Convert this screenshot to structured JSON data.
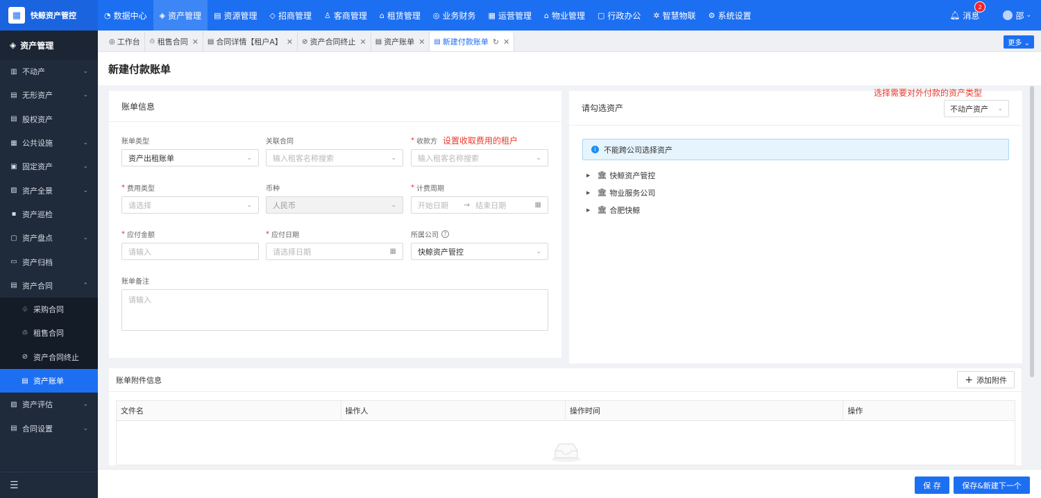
{
  "brand": {
    "name": "快鲸资产管控",
    "logo_icon": "building-icon"
  },
  "topnav": [
    {
      "label": "数据中心",
      "icon": "◔",
      "active": false
    },
    {
      "label": "资产管理",
      "icon": "◈",
      "active": true
    },
    {
      "label": "资源管理",
      "icon": "▤",
      "active": false
    },
    {
      "label": "招商管理",
      "icon": "◇",
      "active": false
    },
    {
      "label": "客商管理",
      "icon": "♙",
      "active": false
    },
    {
      "label": "租赁管理",
      "icon": "⌂",
      "active": false
    },
    {
      "label": "业务财务",
      "icon": "◎",
      "active": false
    },
    {
      "label": "运营管理",
      "icon": "▦",
      "active": false
    },
    {
      "label": "物业管理",
      "icon": "⌂",
      "active": false
    },
    {
      "label": "行政办公",
      "icon": "▢",
      "active": false
    },
    {
      "label": "智慧物联",
      "icon": "✲",
      "active": false
    },
    {
      "label": "系统设置",
      "icon": "⚙",
      "active": false
    }
  ],
  "top_right": {
    "messages_label": "消息",
    "messages_count": "2",
    "user_name": "邵"
  },
  "sidebar": {
    "title": "资产管理",
    "items": [
      {
        "label": "不动产",
        "icon": "▥",
        "chevron": "⌄"
      },
      {
        "label": "无形资产",
        "icon": "▤",
        "chevron": "⌄"
      },
      {
        "label": "股权资产",
        "icon": "▤",
        "chevron": ""
      },
      {
        "label": "公共设施",
        "icon": "▦",
        "chevron": "⌄"
      },
      {
        "label": "固定资产",
        "icon": "▣",
        "chevron": "⌄"
      },
      {
        "label": "资产全景",
        "icon": "▨",
        "chevron": "⌄"
      },
      {
        "label": "资产巡检",
        "icon": "▪",
        "chevron": ""
      },
      {
        "label": "资产盘点",
        "icon": "▢",
        "chevron": "⌄"
      },
      {
        "label": "资产归档",
        "icon": "▭",
        "chevron": ""
      },
      {
        "label": "资产合同",
        "icon": "▤",
        "chevron": "⌃"
      }
    ],
    "sub_items": [
      {
        "label": "采购合同",
        "icon": "♧",
        "active": false
      },
      {
        "label": "租售合同",
        "icon": "♲",
        "active": false
      },
      {
        "label": "资产合同终止",
        "icon": "⊘",
        "active": false
      },
      {
        "label": "资产账单",
        "icon": "▤",
        "active": true
      }
    ],
    "items_after": [
      {
        "label": "资产评估",
        "icon": "▨",
        "chevron": "⌄"
      },
      {
        "label": "合同设置",
        "icon": "▤",
        "chevron": "⌄"
      }
    ],
    "footer_icon": "☰"
  },
  "tabs": [
    {
      "label": "工作台",
      "icon": "◎",
      "closable": false,
      "active": false
    },
    {
      "label": "租售合同",
      "icon": "♲",
      "closable": true,
      "active": false
    },
    {
      "label": "合同详情【租户A】",
      "icon": "▤",
      "closable": true,
      "active": false
    },
    {
      "label": "资产合同终止",
      "icon": "⊘",
      "closable": true,
      "active": false
    },
    {
      "label": "资产账单",
      "icon": "▤",
      "closable": true,
      "active": false
    },
    {
      "label": "新建付款账单",
      "icon": "▤",
      "closable": true,
      "active": true,
      "refresh": "↻"
    }
  ],
  "more_button": "更多",
  "page_title": "新建付款账单",
  "bill_info": {
    "title": "账单信息",
    "bill_type": {
      "label": "账单类型",
      "value": "资产出租账单",
      "required": false
    },
    "related_contract": {
      "label": "关联合同",
      "placeholder": "输入租客名称搜索"
    },
    "payee": {
      "label": "收款方",
      "placeholder": "输入租客名称搜索",
      "required": true
    },
    "payee_annotation": "设置收取费用的租户",
    "fee_type": {
      "label": "费用类型",
      "placeholder": "请选择",
      "required": true
    },
    "currency": {
      "label": "币种",
      "value": "人民币"
    },
    "billing_period": {
      "label": "计费周期",
      "start_placeholder": "开始日期",
      "separator": "→",
      "end_placeholder": "结束日期",
      "required": true
    },
    "amount": {
      "label": "应付金额",
      "placeholder": "请输入",
      "required": true
    },
    "due_date": {
      "label": "应付日期",
      "placeholder": "请选择日期",
      "required": true
    },
    "company": {
      "label": "所属公司",
      "value": "快鲸资产管控",
      "help": "?"
    },
    "remark": {
      "label": "账单备注",
      "placeholder": "请输入"
    }
  },
  "asset_select": {
    "title": "请勾选资产",
    "annotation": "选择需要对外付款的资产类型",
    "type_value": "不动产资产",
    "notice": "不能跨公司选择资产",
    "tree": [
      {
        "label": "快鲸资产管控"
      },
      {
        "label": "物业服务公司"
      },
      {
        "label": "合肥快鲸"
      }
    ]
  },
  "attachments": {
    "title": "账单附件信息",
    "add_button": "添加附件",
    "columns": [
      "文件名",
      "操作人",
      "操作时间",
      "操作"
    ]
  },
  "footer": {
    "save": "保 存",
    "save_next": "保存&新建下一个"
  },
  "colors": {
    "primary": "#1d6ff2",
    "sidebar": "#1f2a3a",
    "annotation": "#e8392c",
    "required": "#f5222d"
  }
}
